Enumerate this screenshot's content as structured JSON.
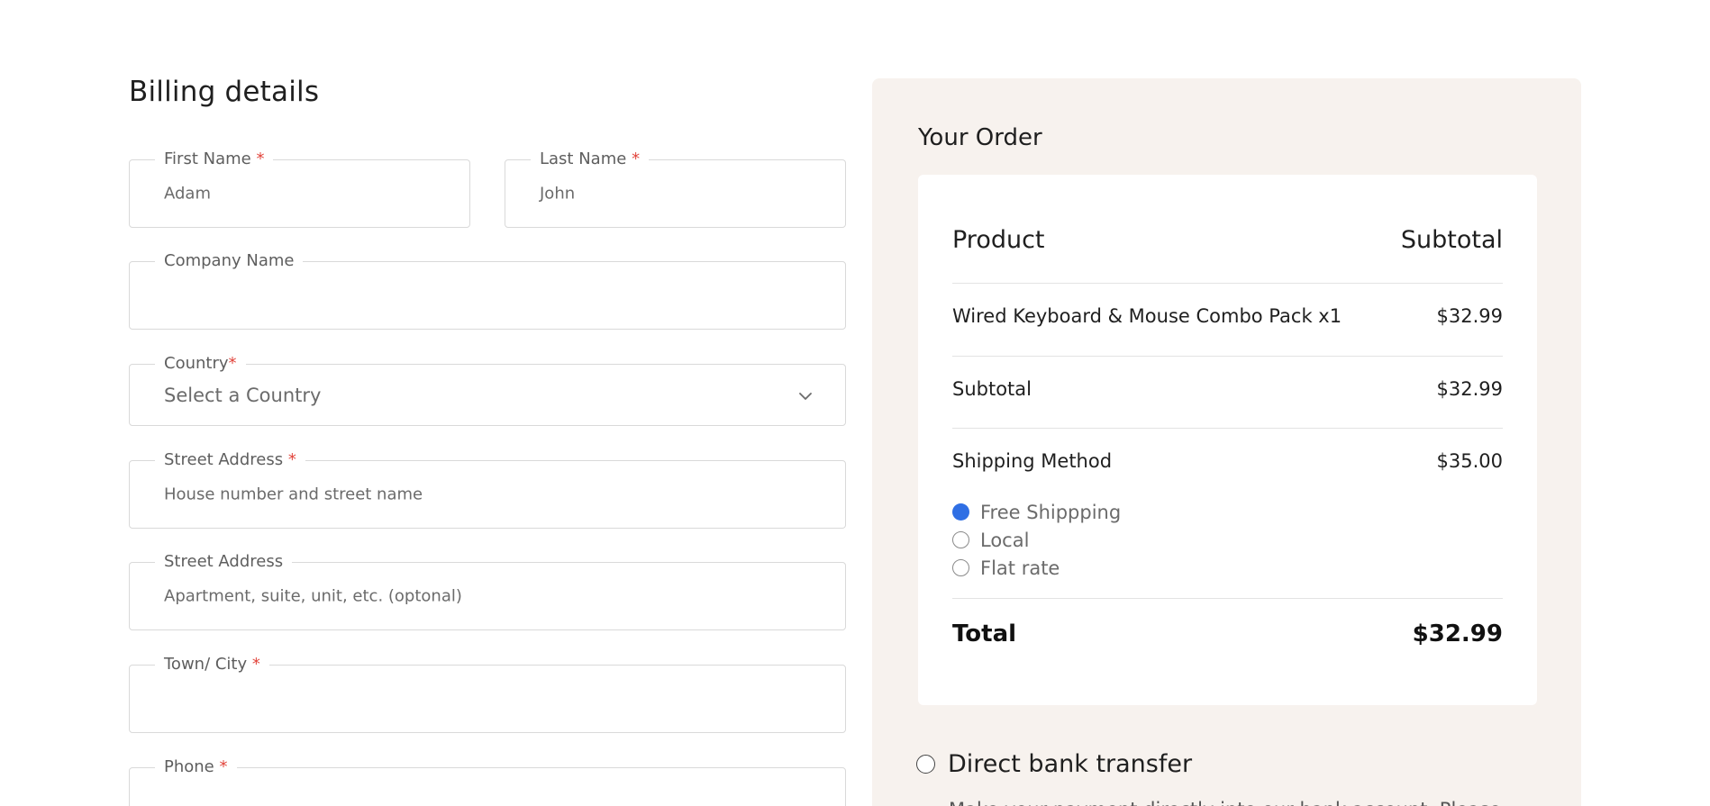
{
  "billing": {
    "title": "Billing details",
    "first_name": {
      "label": "First Name",
      "required": "*",
      "value": "Adam"
    },
    "last_name": {
      "label": "Last Name",
      "required": "*",
      "value": "John"
    },
    "company": {
      "label": "Company Name",
      "value": ""
    },
    "country": {
      "label": "Country",
      "required": "*",
      "selected": "Select a Country"
    },
    "street1": {
      "label": "Street Address",
      "required": "*",
      "placeholder": "House number and street name"
    },
    "street2": {
      "label": "Street Address",
      "placeholder": "Apartment, suite, unit, etc. (optonal)"
    },
    "city": {
      "label": "Town/ City",
      "required": "*",
      "value": ""
    },
    "phone": {
      "label": "Phone",
      "required": "*",
      "value": ""
    }
  },
  "order": {
    "title": "Your Order",
    "header": {
      "product": "Product",
      "subtotal": "Subtotal"
    },
    "item": {
      "name": "Wired Keyboard & Mouse Combo Pack x1",
      "price": "$32.99"
    },
    "subtotal": {
      "label": "Subtotal",
      "value": "$32.99"
    },
    "shipping": {
      "label": "Shipping Method",
      "value": "$35.00",
      "options": [
        {
          "label": "Free Shippping",
          "checked": true
        },
        {
          "label": "Local",
          "checked": false
        },
        {
          "label": "Flat rate",
          "checked": false
        }
      ]
    },
    "total": {
      "label": "Total",
      "value": "$32.99"
    }
  },
  "payment": {
    "bank_transfer": {
      "label": "Direct bank transfer",
      "description": "Make your payment directly into our bank account. Please"
    }
  },
  "colors": {
    "required": "#e2453c",
    "panel_bg": "#f7f2ee",
    "radio_checked": "#2f6fe4"
  },
  "icons": {
    "country_dropdown": "chevron-down-icon"
  }
}
